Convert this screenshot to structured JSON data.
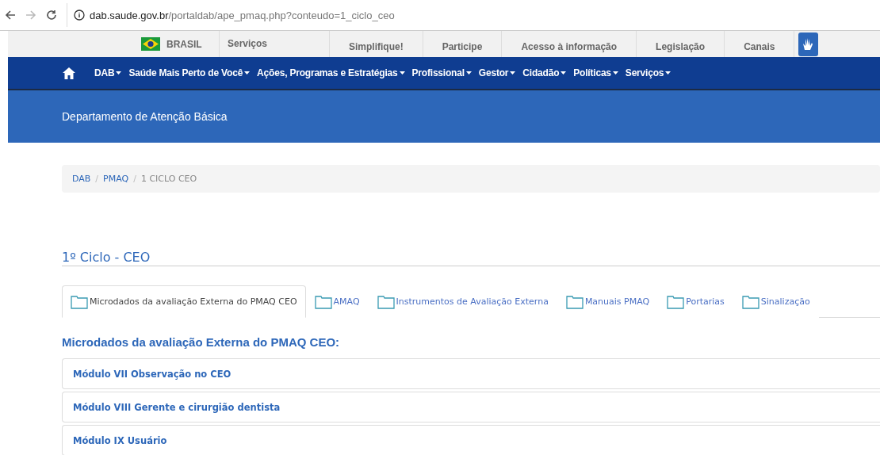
{
  "browser": {
    "url_host": "dab.saude.gov.br",
    "url_path": "/portaldab/ape_pmaq.php?conteudo=1_ciclo_ceo"
  },
  "gov_bar": {
    "brand": "BRASIL",
    "services": "Serviços",
    "links": [
      "Simplifique!",
      "Participe",
      "Acesso à informação",
      "Legislação",
      "Canais"
    ]
  },
  "nav": {
    "items": [
      "DAB",
      "Saúde Mais Perto de Você",
      "Ações, Programas e Estratégias",
      "Profissional",
      "Gestor",
      "Cidadão",
      "Políticas",
      "Serviços"
    ]
  },
  "header": {
    "title": "Departamento de Atenção Básica"
  },
  "breadcrumb": [
    {
      "label": "DAB",
      "current": false
    },
    {
      "separator": "/",
      "label": "PMAQ",
      "current": false
    },
    {
      "separator": "/",
      "label": "1 CICLO CEO",
      "current": true
    }
  ],
  "page_title": "1º Ciclo - CEO",
  "tabs": [
    {
      "label": "Microdados da avaliação Externa do PMAQ CEO",
      "selected": true
    },
    {
      "label": "AMAQ",
      "selected": false
    },
    {
      "label": "Instrumentos de Avaliação Externa",
      "selected": false
    },
    {
      "label": "Manuais PMAQ",
      "selected": false
    },
    {
      "label": "Portarias",
      "selected": false
    },
    {
      "label": "Sinalização",
      "selected": false
    }
  ],
  "section_title": "Microdados da avaliação Externa do PMAQ CEO:",
  "panels": [
    "Módulo VII Observação no CEO",
    "Módulo VIII Gerente e cirurgião dentista",
    "Módulo IX Usuário"
  ]
}
